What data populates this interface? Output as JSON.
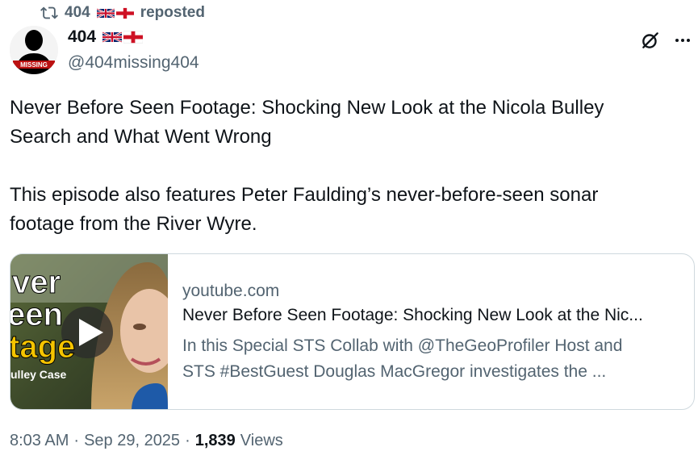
{
  "repost": {
    "user": "404",
    "label": "reposted"
  },
  "author": {
    "name": "404",
    "handle": "@404missing404",
    "avatar_text": "MISSING"
  },
  "post": {
    "lines": [
      "Never Before Seen Footage: Shocking New Look at the Nicola Bulley",
      "Search and What Went Wrong",
      "This episode also features Peter Faulding’s never-before-seen sonar",
      "footage from the River Wyre."
    ]
  },
  "card": {
    "domain": "youtube.com",
    "title": "Never Before Seen Footage: Shocking New Look at the Nic...",
    "desc_line1": "In this Special STS Collab with @TheGeoProfiler Host and",
    "desc_line2": "STS #BestGuest Douglas MacGregor investigates the ...",
    "thumb_text": [
      "ver",
      "een",
      "tage",
      "ulley Case"
    ]
  },
  "meta": {
    "time": "8:03 AM",
    "date": "Sep 29, 2025",
    "views_count": "1,839",
    "views_label": "Views"
  },
  "colors": {
    "text": "#0f1419",
    "secondary": "#536471",
    "border": "#cfd9de",
    "thumb_text": "#f5c400"
  },
  "icons": {
    "repost": "repost-icon",
    "grok": "grok-icon",
    "more": "more-icon",
    "play": "play-icon"
  }
}
